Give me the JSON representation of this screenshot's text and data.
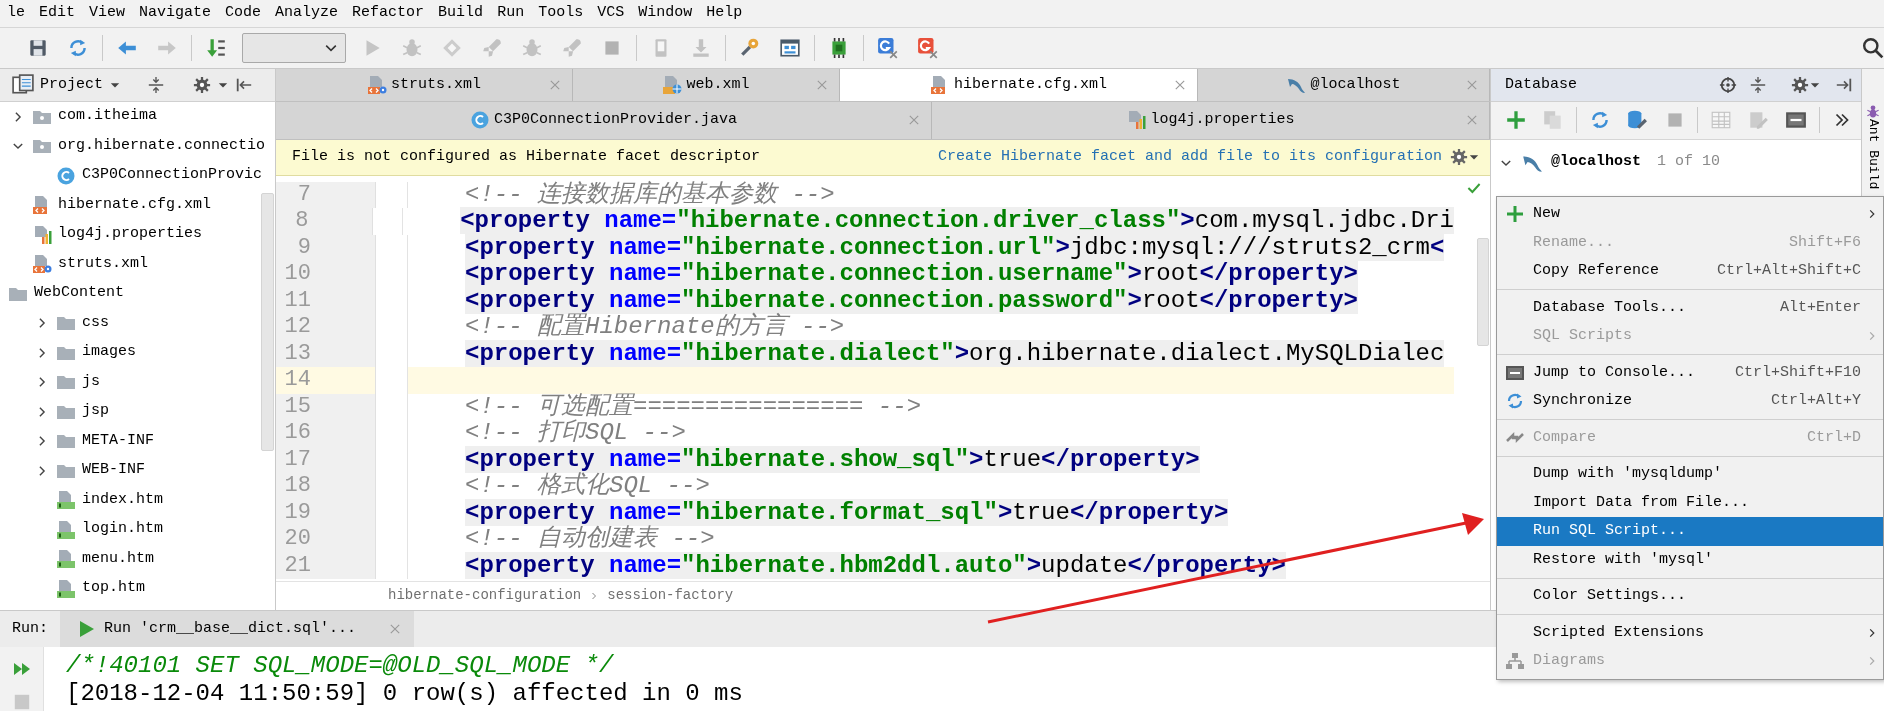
{
  "menubar": [
    "le",
    "Edit",
    "View",
    "Navigate",
    "Code",
    "Analyze",
    "Refactor",
    "Build",
    "Run",
    "Tools",
    "VCS",
    "Window",
    "Help"
  ],
  "toolbar": [
    [
      {
        "kind": "save",
        "disabled": false
      },
      {
        "kind": "sync",
        "disabled": false
      }
    ],
    [
      {
        "kind": "back",
        "disabled": false
      },
      {
        "kind": "forward",
        "disabled": true
      }
    ],
    [
      {
        "kind": "build",
        "disabled": false
      },
      {
        "kind": "dropdown",
        "disabled": false
      },
      {
        "kind": "run",
        "disabled": true
      },
      {
        "kind": "debug",
        "disabled": true
      },
      {
        "kind": "coverage",
        "disabled": true
      },
      {
        "kind": "profile",
        "disabled": true
      },
      {
        "kind": "debug",
        "disabled": true
      },
      {
        "kind": "rocket",
        "disabled": true
      },
      {
        "kind": "stop",
        "disabled": true
      }
    ],
    [
      {
        "kind": "device",
        "disabled": true
      },
      {
        "kind": "deploy",
        "disabled": true
      }
    ],
    [
      {
        "kind": "settings",
        "disabled": false
      },
      {
        "kind": "structure",
        "disabled": false
      }
    ],
    [
      {
        "kind": "sdk",
        "disabled": false
      }
    ],
    [
      {
        "kind": "translate",
        "color": "#3b7dd8",
        "disabled": false
      },
      {
        "kind": "translate",
        "color": "#e8503a",
        "disabled": false
      }
    ]
  ],
  "project": {
    "title": "Project",
    "tree": [
      {
        "label": "com.itheima",
        "kind": "package",
        "expanded": false
      },
      {
        "label": "org.hibernate.connectio",
        "kind": "package",
        "expanded": true,
        "children": [
          {
            "label": "C3P0ConnectionProvic",
            "kind": "java"
          }
        ]
      },
      {
        "label": "hibernate.cfg.xml",
        "kind": "xml"
      },
      {
        "label": "log4j.properties",
        "kind": "properties"
      },
      {
        "label": "struts.xml",
        "kind": "struts"
      },
      {
        "label": "WebContent",
        "kind": "module",
        "children": [
          {
            "label": "css",
            "kind": "folder",
            "expanded": false
          },
          {
            "label": "images",
            "kind": "folder",
            "expanded": false
          },
          {
            "label": "js",
            "kind": "folder",
            "expanded": false
          },
          {
            "label": "jsp",
            "kind": "folder",
            "expanded": false
          },
          {
            "label": "META-INF",
            "kind": "folder",
            "expanded": false
          },
          {
            "label": "WEB-INF",
            "kind": "folder",
            "expanded": false
          },
          {
            "label": "index.htm",
            "kind": "html"
          },
          {
            "label": "login.htm",
            "kind": "html"
          },
          {
            "label": "menu.htm",
            "kind": "html"
          },
          {
            "label": "top.htm",
            "kind": "html"
          }
        ]
      }
    ]
  },
  "editor": {
    "tab_rows": [
      [
        {
          "label": "struts.xml",
          "kind": "struts",
          "selected": false
        },
        {
          "label": "web.xml",
          "kind": "web",
          "selected": false
        },
        {
          "label": "hibernate.cfg.xml",
          "kind": "xml",
          "selected": true
        },
        {
          "label": "@localhost",
          "kind": "mysql",
          "selected": false
        }
      ],
      [
        {
          "label": "C3P0ConnectionProvider.java",
          "kind": "java",
          "selected": false
        },
        {
          "label": "log4j.properties",
          "kind": "properties",
          "selected": false
        }
      ]
    ],
    "banner": {
      "message": "File is not configured as Hibernate facet descriptor",
      "link": "Create Hibernate facet and add file to its configuration"
    },
    "lines": [
      {
        "number": "7",
        "current": false,
        "tokens": [
          {
            "kind": "comment",
            "text": "<!-- 连接数据库的基本参数 -->"
          }
        ]
      },
      {
        "number": "8",
        "current": false,
        "tokens": [
          {
            "kind": "tag",
            "text": "<property"
          },
          {
            "kind": "attr",
            "text": " name="
          },
          {
            "kind": "value",
            "text": "\"hibernate.connection.driver_class\""
          },
          {
            "kind": "tag",
            "text": ">"
          },
          {
            "kind": "text",
            "text": "com.mysql.jdbc.Dri"
          }
        ]
      },
      {
        "number": "9",
        "current": false,
        "tokens": [
          {
            "kind": "tag",
            "text": "<property"
          },
          {
            "kind": "attr",
            "text": " name="
          },
          {
            "kind": "value",
            "text": "\"hibernate.connection.url\""
          },
          {
            "kind": "tag",
            "text": ">"
          },
          {
            "kind": "text",
            "text": "jdbc:mysql:///struts2_crm"
          },
          {
            "kind": "tag",
            "text": "<"
          }
        ]
      },
      {
        "number": "10",
        "current": false,
        "tokens": [
          {
            "kind": "tag",
            "text": "<property"
          },
          {
            "kind": "attr",
            "text": " name="
          },
          {
            "kind": "value",
            "text": "\"hibernate.connection.username\""
          },
          {
            "kind": "tag",
            "text": ">"
          },
          {
            "kind": "text",
            "text": "root"
          },
          {
            "kind": "tag",
            "text": "</property>"
          }
        ]
      },
      {
        "number": "11",
        "current": false,
        "tokens": [
          {
            "kind": "tag",
            "text": "<property"
          },
          {
            "kind": "attr",
            "text": " name="
          },
          {
            "kind": "value",
            "text": "\"hibernate.connection.password\""
          },
          {
            "kind": "tag",
            "text": ">"
          },
          {
            "kind": "text",
            "text": "root"
          },
          {
            "kind": "tag",
            "text": "</property>"
          }
        ]
      },
      {
        "number": "12",
        "current": false,
        "tokens": [
          {
            "kind": "comment",
            "text": "<!-- 配置Hibernate的方言 -->"
          }
        ]
      },
      {
        "number": "13",
        "current": false,
        "tokens": [
          {
            "kind": "tag",
            "text": "<property"
          },
          {
            "kind": "attr",
            "text": " name="
          },
          {
            "kind": "value",
            "text": "\"hibernate.dialect\""
          },
          {
            "kind": "tag",
            "text": ">"
          },
          {
            "kind": "text",
            "text": "org.hibernate.dialect.MySQLDialec"
          }
        ]
      },
      {
        "number": "14",
        "current": true
      },
      {
        "number": "15",
        "current": false,
        "tokens": [
          {
            "kind": "comment",
            "text": "<!-- 可选配置================ -->"
          }
        ]
      },
      {
        "number": "16",
        "current": false,
        "tokens": [
          {
            "kind": "comment",
            "text": "<!-- 打印SQL -->"
          }
        ]
      },
      {
        "number": "17",
        "current": false,
        "tokens": [
          {
            "kind": "tag",
            "text": "<property"
          },
          {
            "kind": "attr",
            "text": " name="
          },
          {
            "kind": "value",
            "text": "\"hibernate.show_sql\""
          },
          {
            "kind": "tag",
            "text": ">"
          },
          {
            "kind": "text",
            "text": "true"
          },
          {
            "kind": "tag",
            "text": "</property>"
          }
        ]
      },
      {
        "number": "18",
        "current": false,
        "tokens": [
          {
            "kind": "comment",
            "text": "<!-- 格式化SQL -->"
          }
        ]
      },
      {
        "number": "19",
        "current": false,
        "tokens": [
          {
            "kind": "tag",
            "text": "<property"
          },
          {
            "kind": "attr",
            "text": " name="
          },
          {
            "kind": "value",
            "text": "\"hibernate.format_sql\""
          },
          {
            "kind": "tag",
            "text": ">"
          },
          {
            "kind": "text",
            "text": "true"
          },
          {
            "kind": "tag",
            "text": "</property>"
          }
        ]
      },
      {
        "number": "20",
        "current": false,
        "tokens": [
          {
            "kind": "comment",
            "text": "<!-- 自动创建表 -->"
          }
        ]
      },
      {
        "number": "21",
        "current": false,
        "tokens": [
          {
            "kind": "tag",
            "text": "<property"
          },
          {
            "kind": "attr",
            "text": " name="
          },
          {
            "kind": "value",
            "text": "\"hibernate.hbm2ddl.auto\""
          },
          {
            "kind": "tag",
            "text": ">"
          },
          {
            "kind": "text",
            "text": "update"
          },
          {
            "kind": "tag",
            "text": "</property>"
          }
        ]
      }
    ],
    "breadcrumbs": [
      "hibernate-configuration",
      "session-factory"
    ]
  },
  "run": {
    "label": "Run:",
    "tabs": [
      {
        "label": "Run 'crm__base__dict.sql'...",
        "selected": true
      }
    ],
    "console": [
      {
        "kind": "comment",
        "text": "/*!40101 SET SQL_MODE=@OLD_SQL_MODE */"
      },
      {
        "kind": "output",
        "text": "[2018-12-04 11:50:59] 0 row(s) affected in 0 ms"
      }
    ]
  },
  "database": {
    "title": "Database",
    "toolbar": [
      [
        {
          "kind": "add",
          "disabled": false
        },
        {
          "kind": "copy",
          "disabled": true
        }
      ],
      [
        {
          "kind": "sync",
          "disabled": false
        },
        {
          "kind": "dbtools",
          "disabled": false
        },
        {
          "kind": "stop",
          "disabled": true
        }
      ],
      [
        {
          "kind": "table",
          "disabled": true
        },
        {
          "kind": "edit",
          "disabled": true
        },
        {
          "kind": "console",
          "disabled": false
        }
      ],
      [
        {
          "kind": "more",
          "disabled": false
        }
      ]
    ],
    "tree": [
      {
        "label": "@localhost",
        "count": "1 of 10",
        "expanded": true
      }
    ]
  },
  "side_strip": {
    "label": "Ant Build"
  },
  "context_menu": {
    "groups": [
      [
        {
          "label": "New",
          "kind": "add",
          "disabled": false,
          "selected": false,
          "submenu": true
        },
        {
          "label": "Rename...",
          "kind": "plain",
          "shortcut": "Shift+F6",
          "disabled": true,
          "selected": false
        },
        {
          "label": "Copy Reference",
          "kind": "plain",
          "shortcut": "Ctrl+Alt+Shift+C",
          "disabled": false,
          "selected": false
        }
      ],
      [
        {
          "label": "Database Tools...",
          "kind": "plain",
          "shortcut": "Alt+Enter",
          "disabled": false,
          "selected": false
        },
        {
          "label": "SQL Scripts",
          "kind": "plain",
          "disabled": true,
          "selected": false,
          "submenu": true
        }
      ],
      [
        {
          "label": "Jump to Console...",
          "kind": "console",
          "shortcut": "Ctrl+Shift+F10",
          "disabled": false,
          "selected": false
        },
        {
          "label": "Synchronize",
          "kind": "sync",
          "shortcut": "Ctrl+Alt+Y",
          "disabled": false,
          "selected": false
        }
      ],
      [
        {
          "label": "Compare",
          "kind": "compare",
          "shortcut": "Ctrl+D",
          "disabled": true,
          "selected": false
        }
      ],
      [
        {
          "label": "Dump with 'mysqldump'",
          "kind": "plain",
          "disabled": false,
          "selected": false
        },
        {
          "label": "Import Data from File...",
          "kind": "plain",
          "disabled": false,
          "selected": false
        },
        {
          "label": "Run SQL Script...",
          "kind": "plain",
          "disabled": false,
          "selected": true
        },
        {
          "label": "Restore with 'mysql'",
          "kind": "plain",
          "disabled": false,
          "selected": false
        }
      ],
      [
        {
          "label": "Color Settings...",
          "kind": "plain",
          "disabled": false,
          "selected": false
        }
      ],
      [
        {
          "label": "Scripted Extensions",
          "kind": "plain",
          "disabled": false,
          "selected": false,
          "submenu": true
        },
        {
          "label": "Diagrams",
          "kind": "diagram",
          "disabled": true,
          "selected": false,
          "submenu": true
        }
      ]
    ]
  }
}
